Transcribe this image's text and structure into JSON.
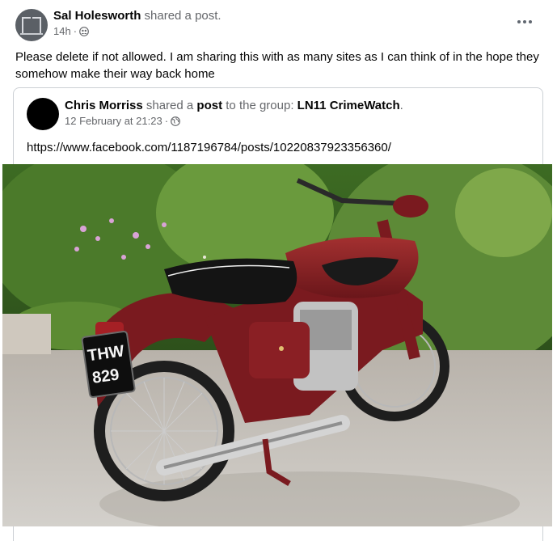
{
  "post": {
    "author_name": "Sal Holesworth",
    "author_action": " shared a post.",
    "time": "14h",
    "privacy_separator": "·",
    "privacy_icon": "friends-icon",
    "more_icon": "more-horizontal-icon",
    "text": "Please delete if not allowed. I am sharing this with as many sites as I can think of in the hope they somehow make their way back home"
  },
  "shared_post": {
    "author_name": "Chris Morriss",
    "action_prefix": " shared a ",
    "action_keyword": "post",
    "action_middle": " to the group: ",
    "group_name": "LN11 CrimeWatch",
    "action_suffix": ".",
    "date": "12 February at 21:23",
    "privacy_separator": "·",
    "privacy_icon": "globe-icon",
    "link_text": "https://www.facebook.com/1187196784/posts/10220837923356360/",
    "image": {
      "subject": "motorcycle",
      "plate_line1": "THW",
      "plate_line2": "829",
      "colors": {
        "bike_body": "#7a1a1f",
        "foliage": "#4f7a2e",
        "driveway": "#c7c3bd"
      }
    }
  }
}
